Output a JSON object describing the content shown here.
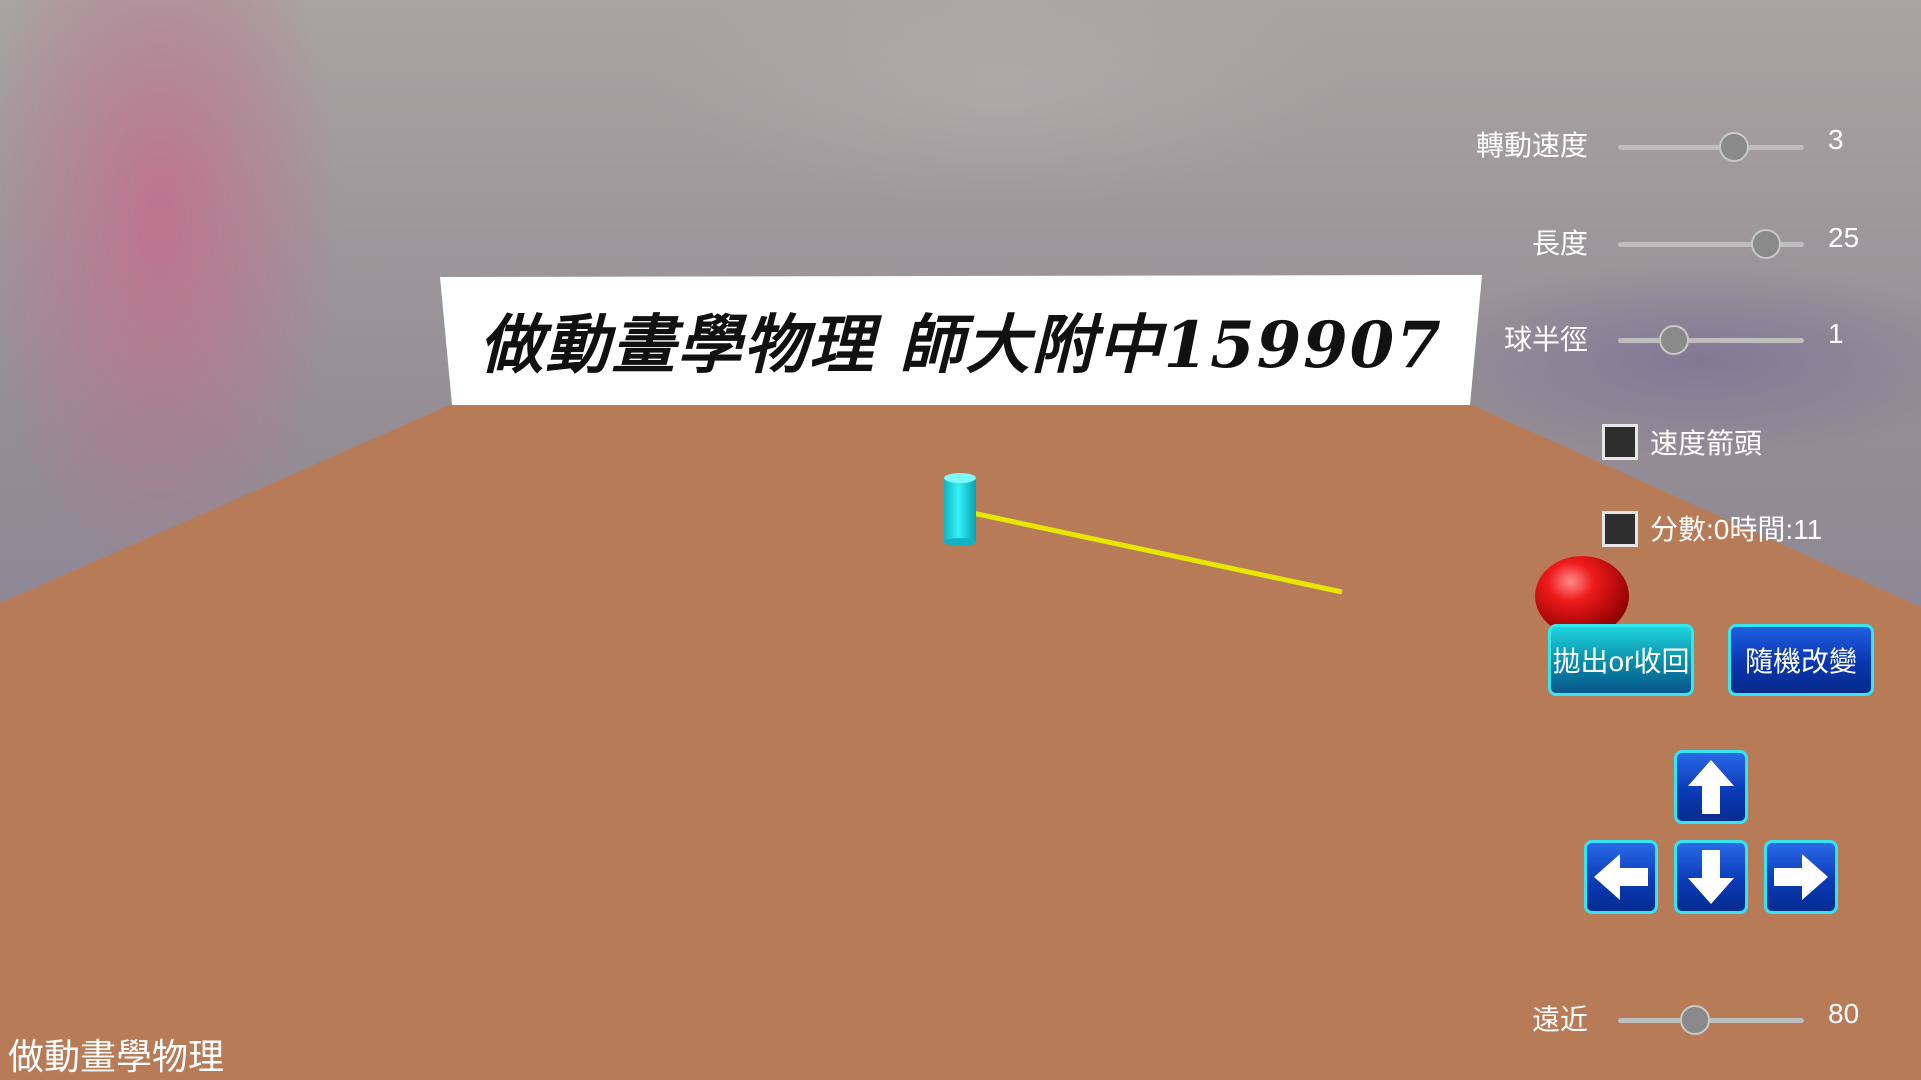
{
  "banner": {
    "text": "做動畫學物理 師大附中159907"
  },
  "bottom_title": "做動畫學物理",
  "controls": {
    "rotation_speed": {
      "label": "轉動速度",
      "value": "3",
      "level": 0.65
    },
    "length": {
      "label": "長度",
      "value": "25",
      "level": 0.85
    },
    "ball_radius": {
      "label": "球半徑",
      "value": "1",
      "level": 0.26
    },
    "distance": {
      "label": "遠近",
      "value": "80",
      "level": 0.4
    }
  },
  "checkboxes": {
    "velocity_arrow": {
      "label": "速度箭頭",
      "checked": false
    },
    "score_time": {
      "label": "分數:0時間:11",
      "checked": false
    }
  },
  "buttons": {
    "throw_retract": "拋出or收回",
    "random_change": "隨機改變"
  },
  "arrows": [
    "up-arrow-icon",
    "left-arrow-icon",
    "down-arrow-icon",
    "right-arrow-icon"
  ],
  "colors": {
    "floor": "#b87b58",
    "cylinder": "#22e0e8",
    "rod": "#e6e600",
    "ball": "#e01010",
    "button_border": "#33e6f0"
  }
}
